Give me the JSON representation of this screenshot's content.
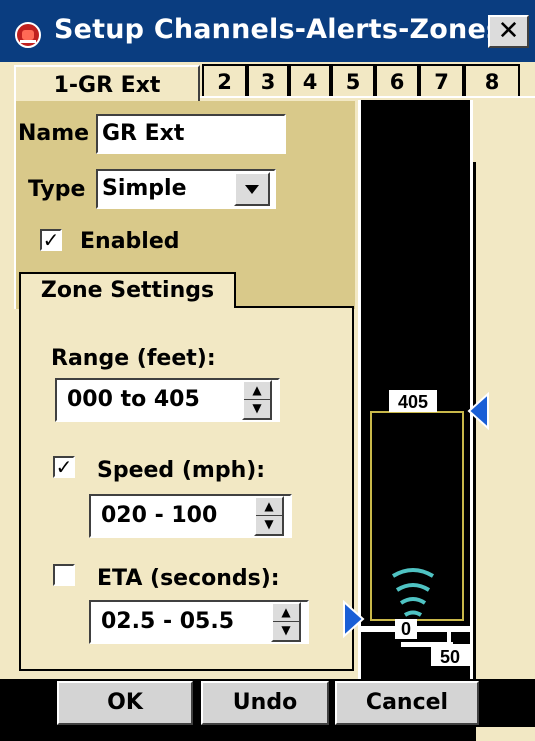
{
  "window": {
    "title": "Setup Channels-Alerts-Zones",
    "close_label": "✕",
    "icon": "alert-siren-icon"
  },
  "tabs": [
    {
      "label": "1-GR Ext",
      "active": true
    },
    {
      "label": "2"
    },
    {
      "label": "3"
    },
    {
      "label": "4"
    },
    {
      "label": "5"
    },
    {
      "label": "6"
    },
    {
      "label": "7"
    },
    {
      "label": "8"
    }
  ],
  "general": {
    "name_label": "Name",
    "name_value": "GR Ext",
    "type_label": "Type",
    "type_value": "Simple",
    "enabled_label": "Enabled",
    "enabled_checked": true
  },
  "zone": {
    "group_label": "Zone Settings",
    "range_label": "Range (feet):",
    "range_value": "000 to 405",
    "speed_label": "Speed (mph):",
    "speed_checked": true,
    "speed_value": "020 - 100",
    "eta_label": "ETA (seconds):",
    "eta_checked": false,
    "eta_value": "02.5 - 05.5"
  },
  "visualization": {
    "top_label": "405",
    "bottom_label": "0",
    "scale_label": "50",
    "zone_color": "#c9b84a",
    "marker_color": "#1a5fd6",
    "signal_color": "#4fc3c3"
  },
  "buttons": {
    "ok": "OK",
    "undo": "Undo",
    "cancel": "Cancel"
  }
}
